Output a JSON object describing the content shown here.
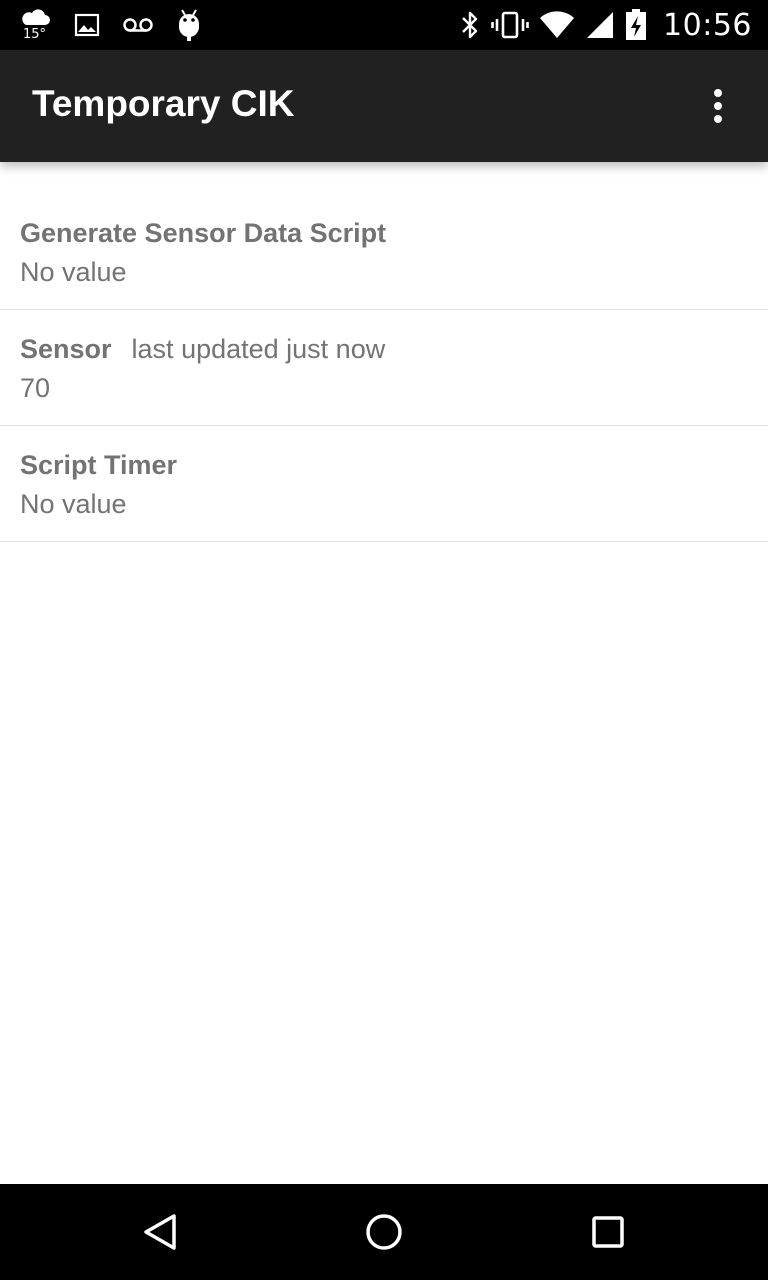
{
  "status_bar": {
    "weather_temp": "15°",
    "time": "10:56",
    "icons_left": [
      "weather-icon",
      "image-icon",
      "voicemail-icon",
      "android-icon"
    ],
    "icons_right": [
      "bluetooth-icon",
      "vibrate-icon",
      "wifi-icon",
      "signal-icon",
      "battery-charging-icon"
    ]
  },
  "action_bar": {
    "title": "Temporary CIK",
    "menu_icon": "overflow-menu-icon"
  },
  "list": {
    "items": [
      {
        "title": "Generate Sensor Data Script",
        "meta": "",
        "value": "No value"
      },
      {
        "title": "Sensor",
        "meta": "last updated just now",
        "value": "70"
      },
      {
        "title": "Script Timer",
        "meta": "",
        "value": "No value"
      }
    ]
  },
  "nav_bar": {
    "icons": [
      "back-icon",
      "home-icon",
      "recents-icon"
    ]
  },
  "colors": {
    "status_bar": "#000000",
    "action_bar": "#212121",
    "text_primary_light": "#ffffff",
    "list_text": "#737373",
    "divider": "#e3e3e3"
  }
}
